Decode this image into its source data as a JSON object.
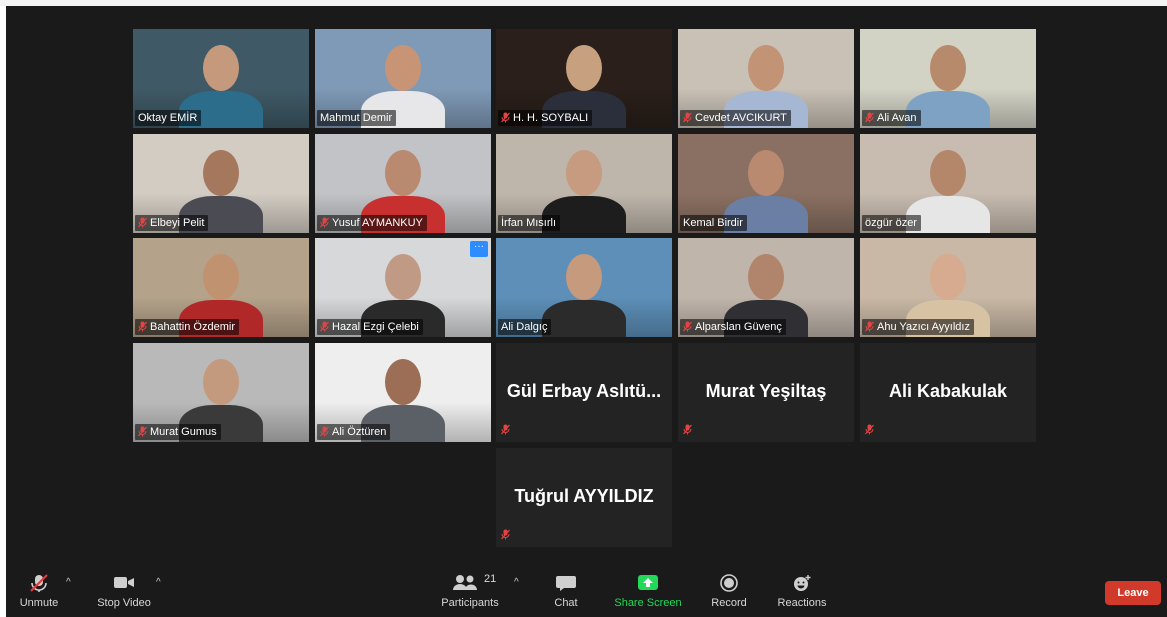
{
  "participants": [
    {
      "name": "Oktay EMİR",
      "muted": false,
      "bg": "#3f5a66",
      "skin": "#c59a7c",
      "shirt": "#2d6d8c"
    },
    {
      "name": "Mahmut Demir",
      "muted": false,
      "bg": "#7f9ab7",
      "skin": "#c79576",
      "shirt": "#e7e7e9"
    },
    {
      "name": "H. H. SOYBALI",
      "muted": true,
      "bg": "#2a1f1a",
      "skin": "#c7a17f",
      "shirt": "#2a2f3b"
    },
    {
      "name": "Cevdet AVCIKURT",
      "muted": true,
      "bg": "#c9c1b6",
      "skin": "#c29375",
      "shirt": "#a6b7d3"
    },
    {
      "name": "Ali Avan",
      "muted": true,
      "bg": "#d2d2c5",
      "skin": "#b78a6b",
      "shirt": "#7ea2c4"
    },
    {
      "name": "Elbeyi Pelit",
      "muted": true,
      "bg": "#d3ccc3",
      "skin": "#a5775c",
      "shirt": "#4b4b53"
    },
    {
      "name": "Yusuf AYMANKUY",
      "muted": true,
      "bg": "#c2c3c6",
      "skin": "#b98a70",
      "shirt": "#c83030"
    },
    {
      "name": "İrfan Mısırlı",
      "muted": false,
      "bg": "#bfb6ab",
      "skin": "#c69b80",
      "shirt": "#1d1d1d"
    },
    {
      "name": "Kemal Birdir",
      "muted": false,
      "bg": "#8a7062",
      "skin": "#b98a6f",
      "shirt": "#6a7fa3"
    },
    {
      "name": "özgür özer",
      "muted": false,
      "bg": "#c8bcb0",
      "skin": "#b5876a",
      "shirt": "#e6e6e6"
    },
    {
      "name": "Bahattin Özdemir",
      "muted": true,
      "bg": "#b4a28a",
      "skin": "#c1926f",
      "shirt": "#b02828"
    },
    {
      "name": "Hazal Ezgi Çelebi",
      "muted": true,
      "bg": "#d7d8da",
      "skin": "#c19a86",
      "shirt": "#2a2a2a"
    },
    {
      "name": "Ali Dalgıç",
      "muted": false,
      "bg": "#5d8fb8",
      "skin": "#c69a7d",
      "shirt": "#2b2b2b"
    },
    {
      "name": "Alparslan Güvenç",
      "muted": true,
      "bg": "#c0b5ab",
      "skin": "#b1856b",
      "shirt": "#2f2f34"
    },
    {
      "name": "Ahu Yazıcı Ayyıldız",
      "muted": true,
      "bg": "#c9b8a5",
      "skin": "#d6ab8f",
      "shirt": "#d7c2a4"
    },
    {
      "name": "Murat Gumus",
      "muted": true,
      "bg": "#b9b9b9",
      "skin": "#c39a7e",
      "shirt": "#3a3a3a"
    },
    {
      "name": "Ali Öztüren",
      "muted": true,
      "bg": "#eeeeee",
      "skin": "#9b6e55",
      "shirt": "#5b5f66"
    }
  ],
  "audio_only": [
    {
      "name": "Gül Erbay Aslıtü..."
    },
    {
      "name": "Murat Yeşiltaş"
    },
    {
      "name": "Ali Kabakulak"
    },
    {
      "name": "Tuğrul AYYILDIZ"
    }
  ],
  "toolbar": {
    "unmute": "Unmute",
    "stop_video": "Stop Video",
    "participants": "Participants",
    "participant_count": "21",
    "chat": "Chat",
    "share_screen": "Share Screen",
    "record": "Record",
    "reactions": "Reactions",
    "leave": "Leave"
  },
  "colors": {
    "accent_share": "#23d959",
    "leave": "#d13a2a",
    "active_speaker": "#c7e64a",
    "more_button": "#2d8cff"
  },
  "icons": {
    "unmute": "microphone-muted-icon",
    "stop_video": "video-camera-icon",
    "participants": "participants-icon",
    "chat": "chat-bubble-icon",
    "share_screen": "share-screen-icon",
    "record": "record-icon",
    "reactions": "reactions-icon"
  }
}
